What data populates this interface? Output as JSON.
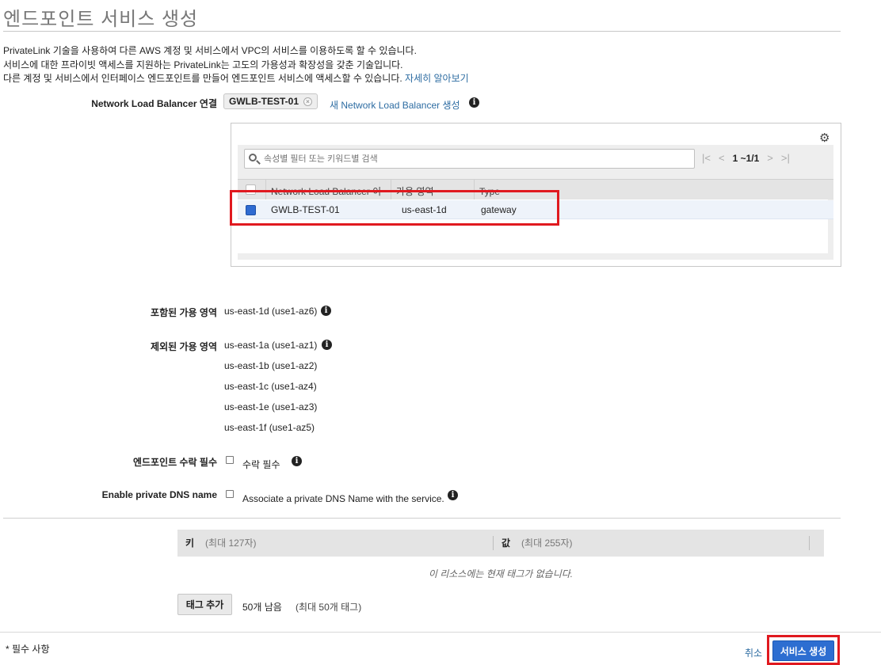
{
  "page": {
    "title": "엔드포인트 서비스 생성",
    "intro": [
      "PrivateLink 기술을 사용하여 다른 AWS 계정 및 서비스에서 VPC의 서비스를 이용하도록 할 수 있습니다.",
      "서비스에 대한 프라이빗 액세스를 지원하는 PrivateLink는 고도의 가용성과 확장성을 갖춘 기술입니다.",
      "다른 계정 및 서비스에서 인터페이스 엔드포인트를 만들어 엔드포인트 서비스에 액세스할 수 있습니다."
    ],
    "learn_more": "자세히 알아보기"
  },
  "nlb": {
    "label": "Network Load Balancer 연결",
    "selected_token": "GWLB-TEST-01",
    "create_link": "새 Network Load Balancer 생성",
    "search_placeholder": "속성별 필터 또는 키워드별 검색",
    "pager": {
      "first": "|<",
      "prev": "<",
      "range": "1 ~1/1",
      "next": ">",
      "last": ">|"
    },
    "columns": [
      "Network Load Balancer 이",
      "가용 영역",
      "Type"
    ],
    "rows": [
      {
        "name": "GWLB-TEST-01",
        "zone": "us-east-1d",
        "type": "gateway",
        "selected": true
      }
    ]
  },
  "zones": {
    "included_label": "포함된 가용 영역",
    "included": [
      "us-east-1d (use1-az6)"
    ],
    "excluded_label": "제외된 가용 영역",
    "excluded": [
      "us-east-1a (use1-az1)",
      "us-east-1b (use1-az2)",
      "us-east-1c (use1-az4)",
      "us-east-1e (use1-az3)",
      "us-east-1f (use1-az5)"
    ]
  },
  "acceptance": {
    "label": "엔드포인트 수락 필수",
    "checkbox_label": "수락 필수"
  },
  "private_dns": {
    "label": "Enable private DNS name",
    "checkbox_label": "Associate a private DNS Name with the service."
  },
  "tags": {
    "key_header": "키",
    "key_hint": "(최대 127자)",
    "value_header": "값",
    "value_hint": "(최대 255자)",
    "empty_message": "이 리소스에는 현재 태그가 없습니다.",
    "add_button": "태그 추가",
    "remaining": "50개 남음",
    "max_hint": "(최대 50개 태그)"
  },
  "footer": {
    "required_note": "* 필수 사항",
    "cancel": "취소",
    "submit": "서비스 생성"
  },
  "colors": {
    "primary_button": "#2d6ed1",
    "highlight_box": "#e0191f",
    "link": "#2d6ca2"
  },
  "icons": [
    "info-icon",
    "gear-icon",
    "search-icon",
    "remove-token-icon",
    "pager-first-icon",
    "pager-prev-icon",
    "pager-next-icon",
    "pager-last-icon"
  ]
}
